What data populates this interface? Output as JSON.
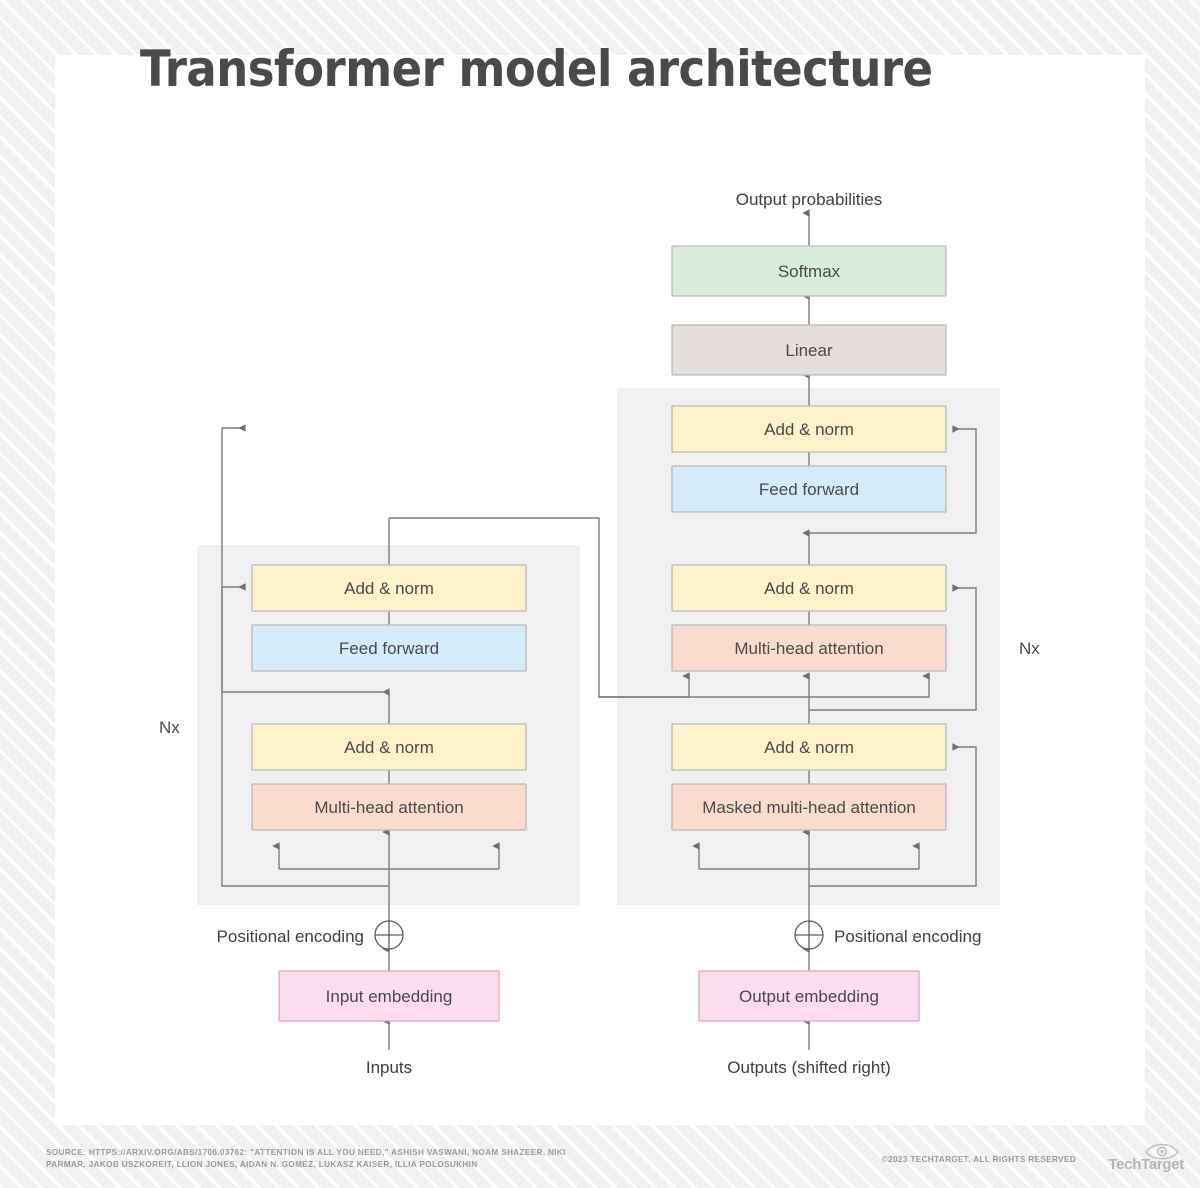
{
  "title": "Transformer model architecture",
  "labels": {
    "output_probabilities": "Output probabilities",
    "nx_left": "Nx",
    "nx_right": "Nx",
    "positional_encoding_left": "Positional encoding",
    "positional_encoding_right": "Positional encoding",
    "inputs": "Inputs",
    "outputs": "Outputs (shifted right)",
    "plus_symbol": "⊕"
  },
  "encoder_boxes": [
    {
      "id": "enc-add-norm-2",
      "label": "Add & norm",
      "fill": "#fdf2cc",
      "stroke": "#b9b9b9"
    },
    {
      "id": "enc-feed-forward",
      "label": "Feed forward",
      "fill": "#d4ecfa",
      "stroke": "#b9b9b9"
    },
    {
      "id": "enc-add-norm-1",
      "label": "Add & norm",
      "fill": "#fdf2cc",
      "stroke": "#b9b9b9"
    },
    {
      "id": "enc-multi-head-attention",
      "label": "Multi-head attention",
      "fill": "#fadbcd",
      "stroke": "#b9b9b9"
    }
  ],
  "decoder_boxes": [
    {
      "id": "dec-add-norm-3",
      "label": "Add & norm",
      "fill": "#fdf2cc",
      "stroke": "#b9b9b9"
    },
    {
      "id": "dec-feed-forward",
      "label": "Feed forward",
      "fill": "#d4ecfa",
      "stroke": "#b9b9b9"
    },
    {
      "id": "dec-add-norm-2",
      "label": "Add & norm",
      "fill": "#fdf2cc",
      "stroke": "#b9b9b9"
    },
    {
      "id": "dec-multi-head-attention",
      "label": "Multi-head attention",
      "fill": "#fadbcd",
      "stroke": "#b9b9b9"
    },
    {
      "id": "dec-add-norm-1",
      "label": "Add & norm",
      "fill": "#fdf2cc",
      "stroke": "#b9b9b9"
    },
    {
      "id": "dec-masked-multi-head-attention",
      "label": "Masked multi-head attention",
      "fill": "#fadbcd",
      "stroke": "#b9b9b9"
    }
  ],
  "head_boxes": [
    {
      "id": "softmax",
      "label": "Softmax",
      "fill": "#d9ecd9",
      "stroke": "#b9b9b9"
    },
    {
      "id": "linear",
      "label": "Linear",
      "fill": "#e4dfda",
      "stroke": "#b9b9b9"
    }
  ],
  "embedding_boxes": [
    {
      "id": "input-embedding",
      "label": "Input embedding",
      "fill": "#fbdeee",
      "stroke": "#d9a8c2"
    },
    {
      "id": "output-embedding",
      "label": "Output embedding",
      "fill": "#fbdeee",
      "stroke": "#d9a8c2"
    }
  ],
  "colors": {
    "panel": "#f0f0f0",
    "line": "#7d7d7d",
    "box_stroke": "#b9b9b9",
    "text": "#4a4a4a",
    "title_text": "#4a4a4a",
    "card": "#ffffff",
    "page_bg": "#f2f2f2",
    "footer_text": "#9a9a9a"
  },
  "footer": {
    "source": "SOURCE: HTTPS://ARXIV.ORG/ABS/1706.03762: \"ATTENTION IS ALL YOU NEED,\" ASHISH VASWANI, NOAM SHAZEER, NIKI PARMAR, JAKOB USZKOREIT, LLION JONES, AIDAN N. GOMEZ, LUKASZ KAISER, ILLIA POLOSUKHIN",
    "copyright": "©2023 TECHTARGET. ALL RIGHTS RESERVED",
    "brand": "TechTarget"
  }
}
